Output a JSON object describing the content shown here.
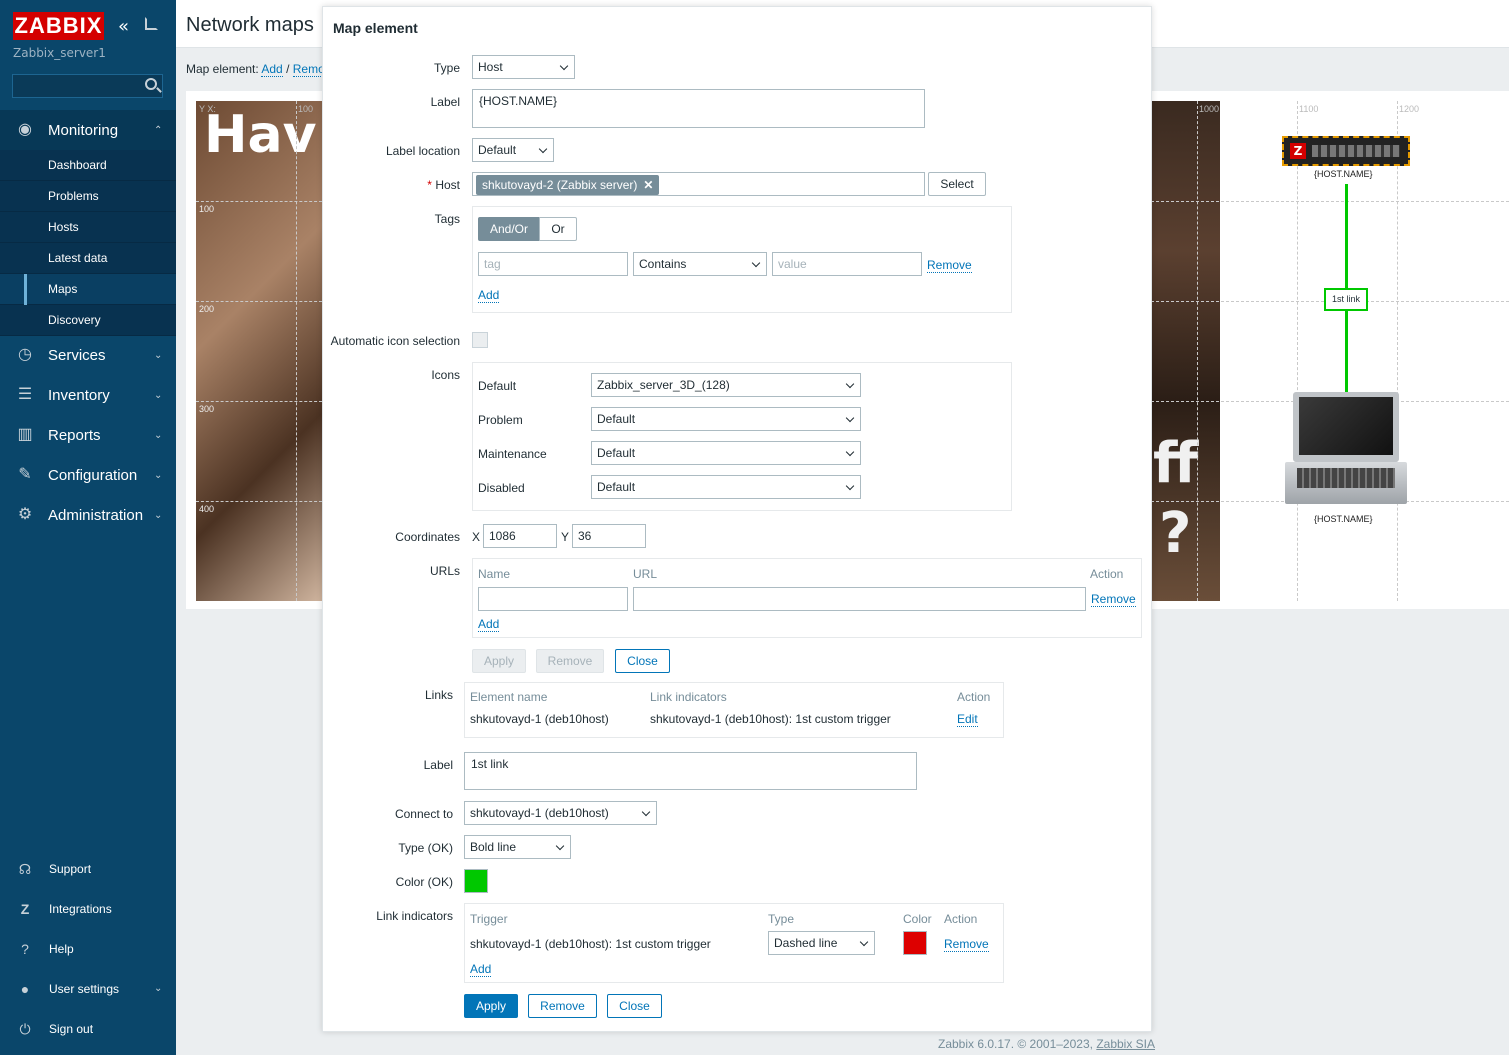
{
  "sidebar": {
    "logo": "ZABBIX",
    "server_name": "Zabbix_server1",
    "sections": [
      {
        "label": "Monitoring",
        "icon": "eye-icon"
      },
      {
        "label": "Services",
        "icon": "clock-icon"
      },
      {
        "label": "Inventory",
        "icon": "list-icon"
      },
      {
        "label": "Reports",
        "icon": "bar-chart-icon"
      },
      {
        "label": "Configuration",
        "icon": "wrench-icon"
      },
      {
        "label": "Administration",
        "icon": "gear-icon"
      }
    ],
    "monitoring_items": [
      "Dashboard",
      "Problems",
      "Hosts",
      "Latest data",
      "Maps",
      "Discovery"
    ],
    "active_item": "Maps",
    "bottom": [
      {
        "label": "Support",
        "icon": "headset-icon"
      },
      {
        "label": "Integrations",
        "icon": "zabbix-z-icon"
      },
      {
        "label": "Help",
        "icon": "question-icon"
      },
      {
        "label": "User settings",
        "icon": "user-icon"
      },
      {
        "label": "Sign out",
        "icon": "power-icon"
      }
    ]
  },
  "page": {
    "title": "Network maps",
    "toolbar_prefix": "Map element:",
    "toolbar_add": "Add",
    "toolbar_sep": "/",
    "toolbar_remove": "Remo",
    "map": {
      "bg_text_left": "Hav",
      "bg_text_right_1": "ff",
      "bg_text_right_2": "?",
      "grid_labels": {
        "yx": "Y X:",
        "x100": "100",
        "x1000": "1000",
        "x1100": "1100",
        "x1200": "1200",
        "y100": "100",
        "y200": "200",
        "y300": "300",
        "y400": "400"
      },
      "host_label_top": "{HOST.NAME}",
      "host_label_bottom": "{HOST.NAME}",
      "link_label": "1st link",
      "link_color": "#00C800"
    }
  },
  "modal": {
    "title": "Map element",
    "type_label": "Type",
    "type_value": "Host",
    "label_label": "Label",
    "label_value": "{HOST.NAME}",
    "label_location_label": "Label location",
    "label_location_value": "Default",
    "host_label": "Host",
    "host_required_mark": "*",
    "host_value": "shkutovayd-2 (Zabbix server)",
    "host_select_button": "Select",
    "tags_label": "Tags",
    "tags_andor": "And/Or",
    "tags_or": "Or",
    "tag_placeholder": "tag",
    "tag_operator": "Contains",
    "tag_value_placeholder": "value",
    "tag_remove": "Remove",
    "tag_add": "Add",
    "auto_icon_label": "Automatic icon selection",
    "icons_label": "Icons",
    "icons": [
      {
        "name": "Default",
        "value": "Zabbix_server_3D_(128)"
      },
      {
        "name": "Problem",
        "value": "Default"
      },
      {
        "name": "Maintenance",
        "value": "Default"
      },
      {
        "name": "Disabled",
        "value": "Default"
      }
    ],
    "coordinates_label": "Coordinates",
    "coord_x_label": "X",
    "coord_x": "1086",
    "coord_y_label": "Y",
    "coord_y": "36",
    "urls_label": "URLs",
    "urls_col_name": "Name",
    "urls_col_url": "URL",
    "urls_col_action": "Action",
    "urls_remove": "Remove",
    "urls_add": "Add",
    "btn_apply_disabled": "Apply",
    "btn_remove_disabled": "Remove",
    "btn_close_top": "Close",
    "links_label": "Links",
    "links_col_element": "Element name",
    "links_col_indicators": "Link indicators",
    "links_col_action": "Action",
    "links_row": {
      "element": "shkutovayd-1 (deb10host)",
      "indicators": "shkutovayd-1 (deb10host): 1st custom trigger",
      "action": "Edit"
    },
    "link_label_label": "Label",
    "link_label_value": "1st link",
    "connect_to_label": "Connect to",
    "connect_to_value": "shkutovayd-1  (deb10host)",
    "type_ok_label": "Type (OK)",
    "type_ok_value": "Bold line",
    "color_ok_label": "Color (OK)",
    "color_ok": "#00C800",
    "link_indicators_label": "Link indicators",
    "li_col_trigger": "Trigger",
    "li_col_type": "Type",
    "li_col_color": "Color",
    "li_col_action": "Action",
    "li_row": {
      "trigger": "shkutovayd-1 (deb10host): 1st custom trigger",
      "type": "Dashed line",
      "color": "#DD0000",
      "action": "Remove"
    },
    "li_add": "Add",
    "btn_apply": "Apply",
    "btn_remove": "Remove",
    "btn_close": "Close"
  },
  "footer": {
    "text": "Zabbix 6.0.17. © 2001–2023,",
    "link": "Zabbix SIA"
  }
}
